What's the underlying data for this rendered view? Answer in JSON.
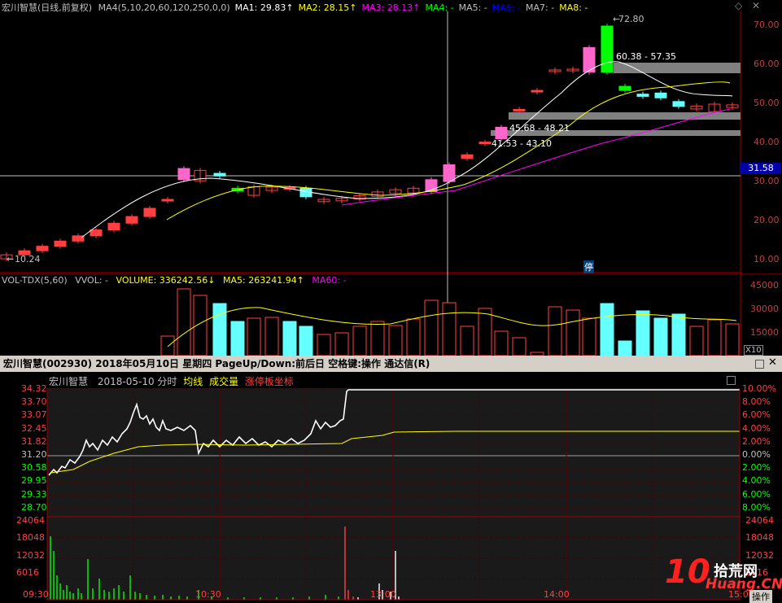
{
  "main": {
    "title": "宏川智慧(日线,前复权)",
    "indicators": [
      {
        "label": "MA4(5,10,20,60,120,250,0,0)",
        "color": "#c0c0c0"
      },
      {
        "label": "MA1: 29.83↑",
        "color": "#ffffff"
      },
      {
        "label": "MA2: 28.15↑",
        "color": "#ffff00"
      },
      {
        "label": "MA3: 28.13↑",
        "color": "#ff00ff"
      },
      {
        "label": "MA4: -",
        "color": "#00ff00"
      },
      {
        "label": "MA5: -",
        "color": "#c0c0c0"
      },
      {
        "label": "MA6: -",
        "color": "#0000ff"
      },
      {
        "label": "MA7: -",
        "color": "#c0c0c0"
      },
      {
        "label": "MA8: -",
        "color": "#ffff00"
      }
    ],
    "price_axis": [
      "70.00",
      "60.00",
      "50.00",
      "40.00",
      "30.00",
      "20.00",
      "10.00"
    ],
    "crosshair_price": "31.58",
    "annotations": {
      "high": "72.80",
      "low": "10.24",
      "gap1": "60.38 - 57.35",
      "gap2": "45.68 - 48.21",
      "gap3": "41.53 - 43.10",
      "halt_marker": "停"
    }
  },
  "volume": {
    "indicator": "VOL-TDX(5,60)",
    "vvol": "VVOL: -",
    "volume": "VOLUME: 336242.56↓",
    "ma5": "MA5: 263241.94↑",
    "ma60": "MA60: -",
    "axis": [
      "45000",
      "30000",
      "15000"
    ],
    "unit": "X10"
  },
  "popup": {
    "title": "宏川智慧(002930)  2018年05月10日  星期四  PageUp/Down:前后日  空格键:操作  通达信(R)",
    "subtitle_name": "宏川智慧",
    "subtitle_date": "2018-05-10 分时",
    "legend_avg": "均线",
    "legend_vol": "成交量",
    "legend_limit": "涨停板坐标",
    "left_axis": [
      "34.32",
      "33.70",
      "33.07",
      "32.45",
      "31.82",
      "31.20",
      "30.58",
      "29.95",
      "29.33",
      "28.70"
    ],
    "right_axis": [
      "10.00%",
      "8.00%",
      "6.00%",
      "4.00%",
      "2.00%",
      "0.00%",
      "2.00%",
      "4.00%",
      "6.00%",
      "8.00%"
    ],
    "vol_left_axis": [
      "24064",
      "18048",
      "12032",
      "6016"
    ],
    "vol_right_axis": [
      "24064",
      "18048",
      "12032",
      "6016"
    ],
    "time_axis": [
      "09:30",
      "10:30",
      "13:00",
      "14:00"
    ],
    "time_end": "15:00"
  },
  "watermark": {
    "big": "10",
    "text1": "拾荒网",
    "text2": "Huang.CN"
  },
  "footer_button": "操作"
}
